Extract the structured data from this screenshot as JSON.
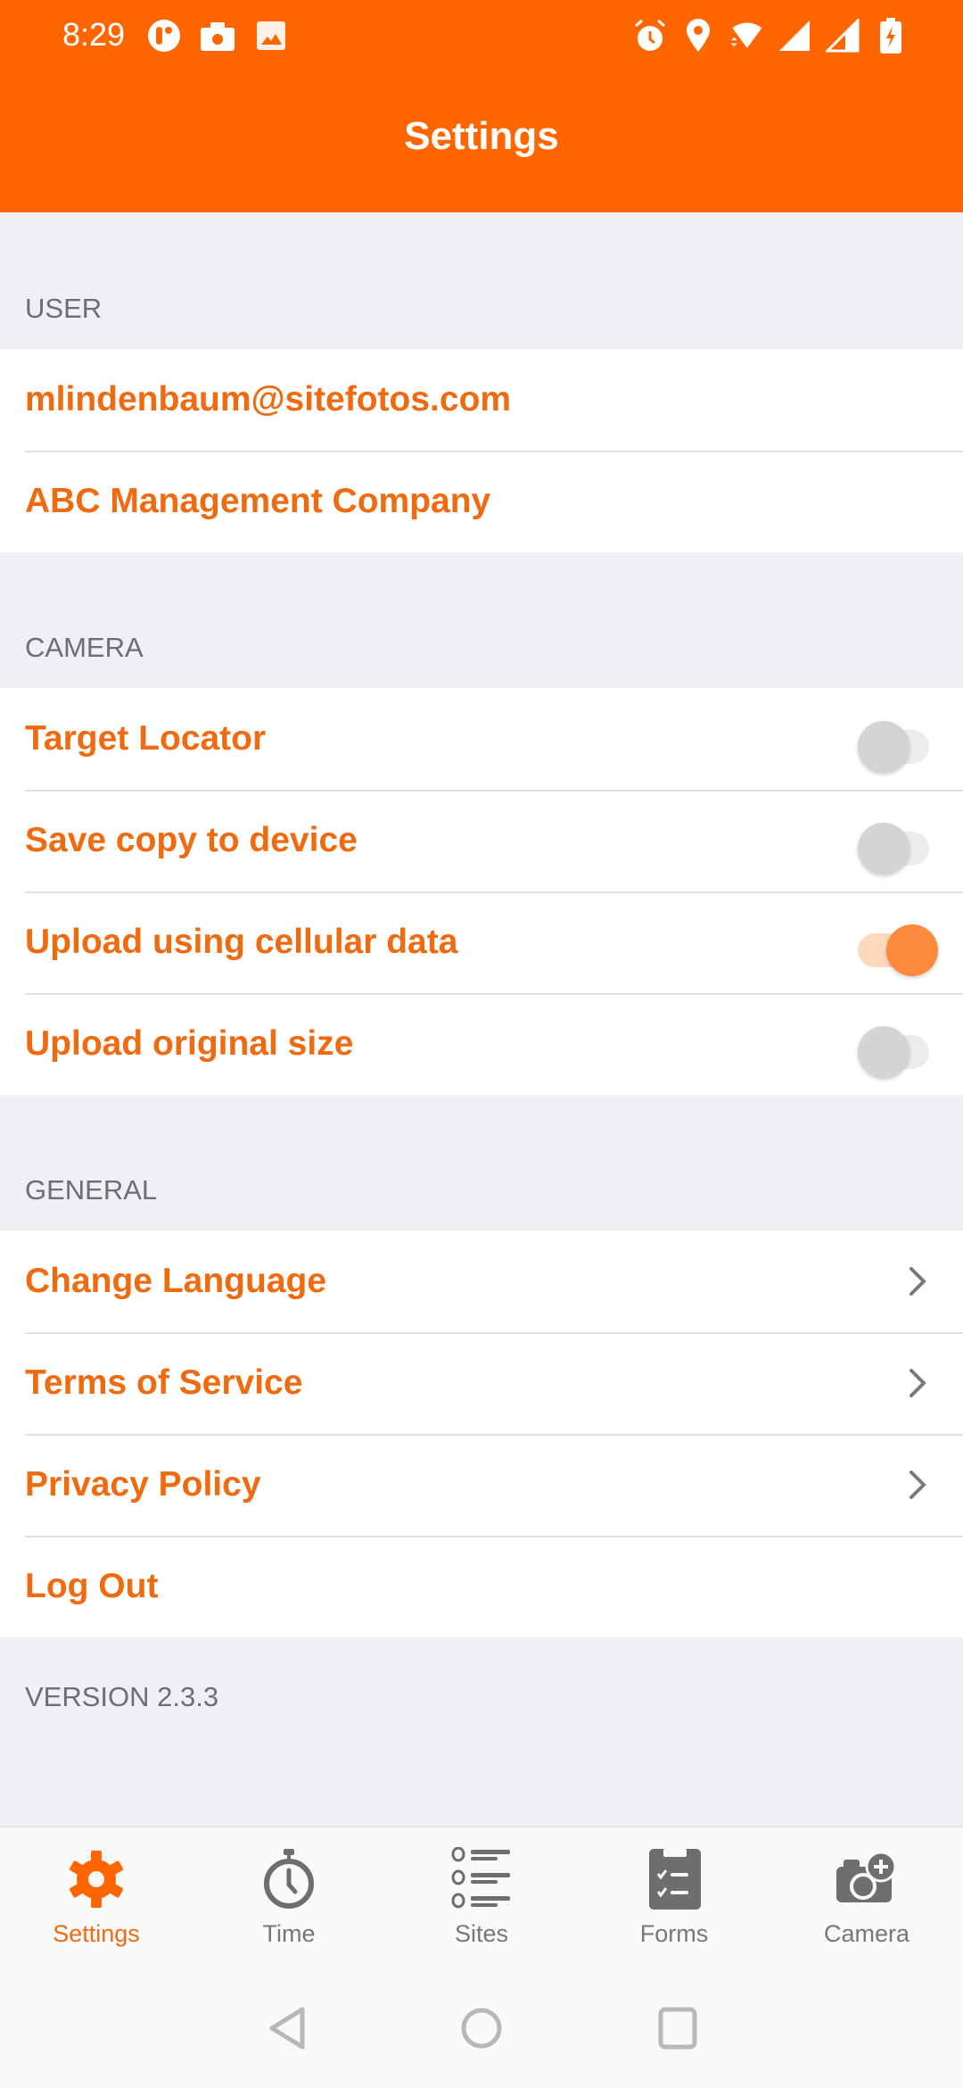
{
  "status_bar": {
    "time": "8:29",
    "left_icons": [
      "app-notification-icon",
      "camera-icon",
      "image-icon"
    ],
    "right_icons": [
      "alarm-icon",
      "location-icon",
      "wifi-icon",
      "signal-icon",
      "signal-icon-2",
      "battery-charging-icon"
    ]
  },
  "header": {
    "title": "Settings"
  },
  "sections": {
    "user": {
      "header": "USER",
      "items": [
        {
          "label": "mlindenbaum@sitefotos.com"
        },
        {
          "label": "ABC Management Company"
        }
      ]
    },
    "camera": {
      "header": "CAMERA",
      "items": [
        {
          "label": "Target Locator",
          "enabled": false
        },
        {
          "label": "Save copy to device",
          "enabled": false
        },
        {
          "label": "Upload using cellular data",
          "enabled": true
        },
        {
          "label": "Upload original size",
          "enabled": false
        }
      ]
    },
    "general": {
      "header": "GENERAL",
      "items": [
        {
          "label": "Change Language",
          "icon": "chevron-right-icon"
        },
        {
          "label": "Terms of Service",
          "icon": "chevron-right-icon"
        },
        {
          "label": "Privacy Policy",
          "icon": "chevron-right-icon"
        },
        {
          "label": "Log Out"
        }
      ]
    }
  },
  "version": "VERSION 2.3.3",
  "tab_bar": {
    "items": [
      {
        "label": "Settings",
        "icon": "gear-icon",
        "active": true
      },
      {
        "label": "Time",
        "icon": "stopwatch-icon",
        "active": false
      },
      {
        "label": "Sites",
        "icon": "list-icon",
        "active": false
      },
      {
        "label": "Forms",
        "icon": "clipboard-icon",
        "active": false
      },
      {
        "label": "Camera",
        "icon": "camera-add-icon",
        "active": false
      }
    ]
  },
  "colors": {
    "brand": "#ff6600",
    "accent_text": "#f06a10",
    "section_text": "#6d6d72",
    "background": "#efeff4",
    "tab_inactive": "#777777"
  }
}
